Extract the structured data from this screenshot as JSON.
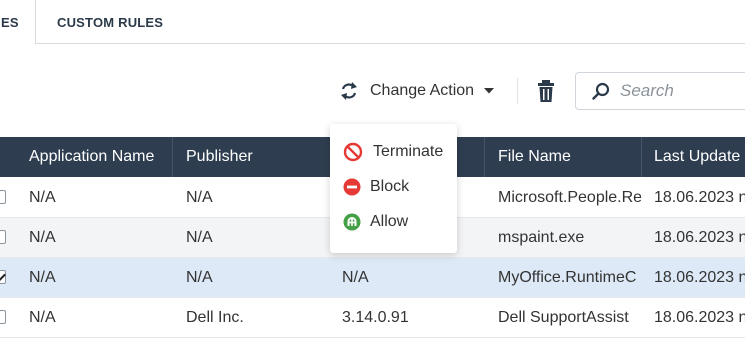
{
  "tabs": [
    {
      "label": "ES"
    },
    {
      "label": "CUSTOM RULES"
    }
  ],
  "toolbar": {
    "change_action_label": "Change Action",
    "search_placeholder": "Search"
  },
  "table": {
    "columns": [
      "Application Name",
      "Publisher",
      "",
      "File Name",
      "Last Update"
    ],
    "rows": [
      {
        "checked": false,
        "cells": [
          "N/A",
          "N/A",
          "",
          "Microsoft.People.Re",
          "18.06.2023 n"
        ]
      },
      {
        "checked": false,
        "cells": [
          "N/A",
          "N/A",
          "",
          "mspaint.exe",
          "18.06.2023 n"
        ]
      },
      {
        "checked": true,
        "cells": [
          "N/A",
          "N/A",
          "N/A",
          "MyOffice.RuntimeC",
          "18.06.2023 n"
        ]
      },
      {
        "checked": false,
        "cells": [
          "N/A",
          "Dell Inc.",
          "3.14.0.91",
          "Dell SupportAssist",
          "18.06.2023 n"
        ]
      }
    ]
  },
  "action_menu": {
    "items": [
      {
        "label": "Terminate",
        "icon": "terminate-icon",
        "color": "#e53935"
      },
      {
        "label": "Block",
        "icon": "block-icon",
        "color": "#e53935"
      },
      {
        "label": "Allow",
        "icon": "allow-icon",
        "color": "#43a047"
      }
    ]
  },
  "colors": {
    "header_bg": "#2e3e50",
    "selected_row": "#dde9f7",
    "alt_row": "#f3f4f6"
  }
}
